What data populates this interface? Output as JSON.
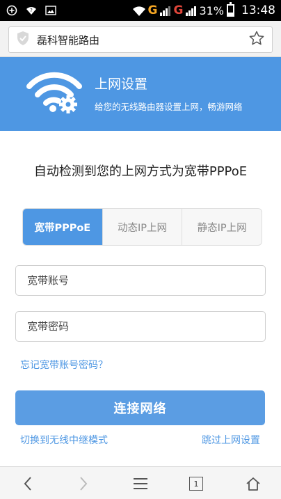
{
  "status_bar": {
    "network_1": "G",
    "network_2": "G",
    "battery_percent": "31%",
    "battery_level": 0.31,
    "time": "13:48"
  },
  "browser": {
    "page_title": "磊科智能路由",
    "tab_count": "1"
  },
  "banner": {
    "title": "上网设置",
    "subtitle": "给您的无线路由器设置上网，畅游网络"
  },
  "main": {
    "detect_text": "自动检测到您的上网方式为宽带PPPoE",
    "tabs": [
      {
        "label": "宽带PPPoE",
        "active": true
      },
      {
        "label": "动态IP上网",
        "active": false
      },
      {
        "label": "静态IP上网",
        "active": false
      }
    ],
    "account_placeholder": "宽带账号",
    "password_placeholder": "宽带密码",
    "forgot_link": "忘记宽带账号密码？",
    "connect_button": "连接网络",
    "switch_link": "切换到无线中继模式",
    "skip_link": "跳过上网设置"
  },
  "icons": {
    "back": "back-arrow-icon",
    "forward": "forward-arrow-icon",
    "menu": "menu-icon",
    "tabs": "tabs-icon",
    "home": "home-icon",
    "bookmark": "star-icon",
    "security": "shield-icon",
    "logo": "wifi-gear-icon"
  },
  "colors": {
    "accent": "#4e97e3",
    "button": "#5b9de3",
    "status_g1": "#f5a623",
    "status_g2": "#e0463a"
  }
}
